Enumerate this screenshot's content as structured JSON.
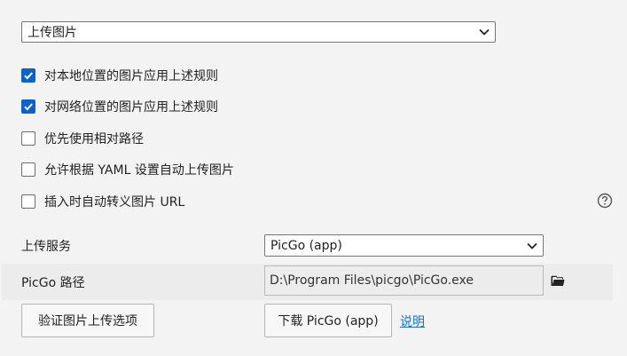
{
  "top_select": {
    "value": "上传图片"
  },
  "checkboxes": [
    {
      "label": "对本地位置的图片应用上述规则",
      "checked": true
    },
    {
      "label": "对网络位置的图片应用上述规则",
      "checked": true
    },
    {
      "label": "优先使用相对路径",
      "checked": false
    },
    {
      "label": "允许根据 YAML 设置自动上传图片",
      "checked": false
    },
    {
      "label": "插入时自动转义图片 URL",
      "checked": false
    }
  ],
  "upload_service": {
    "label": "上传服务",
    "value": "PicGo (app)"
  },
  "picgo_path": {
    "label": "PicGo 路径",
    "value": "D:\\Program Files\\picgo\\PicGo.exe"
  },
  "buttons": {
    "verify": "验证图片上传选项",
    "download": "下载 PicGo (app)",
    "help_link": "说明"
  },
  "icons": {
    "help": "question-circle-icon",
    "folder": "folder-icon",
    "dropdown": "chevron-down-icon"
  },
  "colors": {
    "checkbox_checked": "#0b63c8",
    "link": "#1a73c9"
  }
}
